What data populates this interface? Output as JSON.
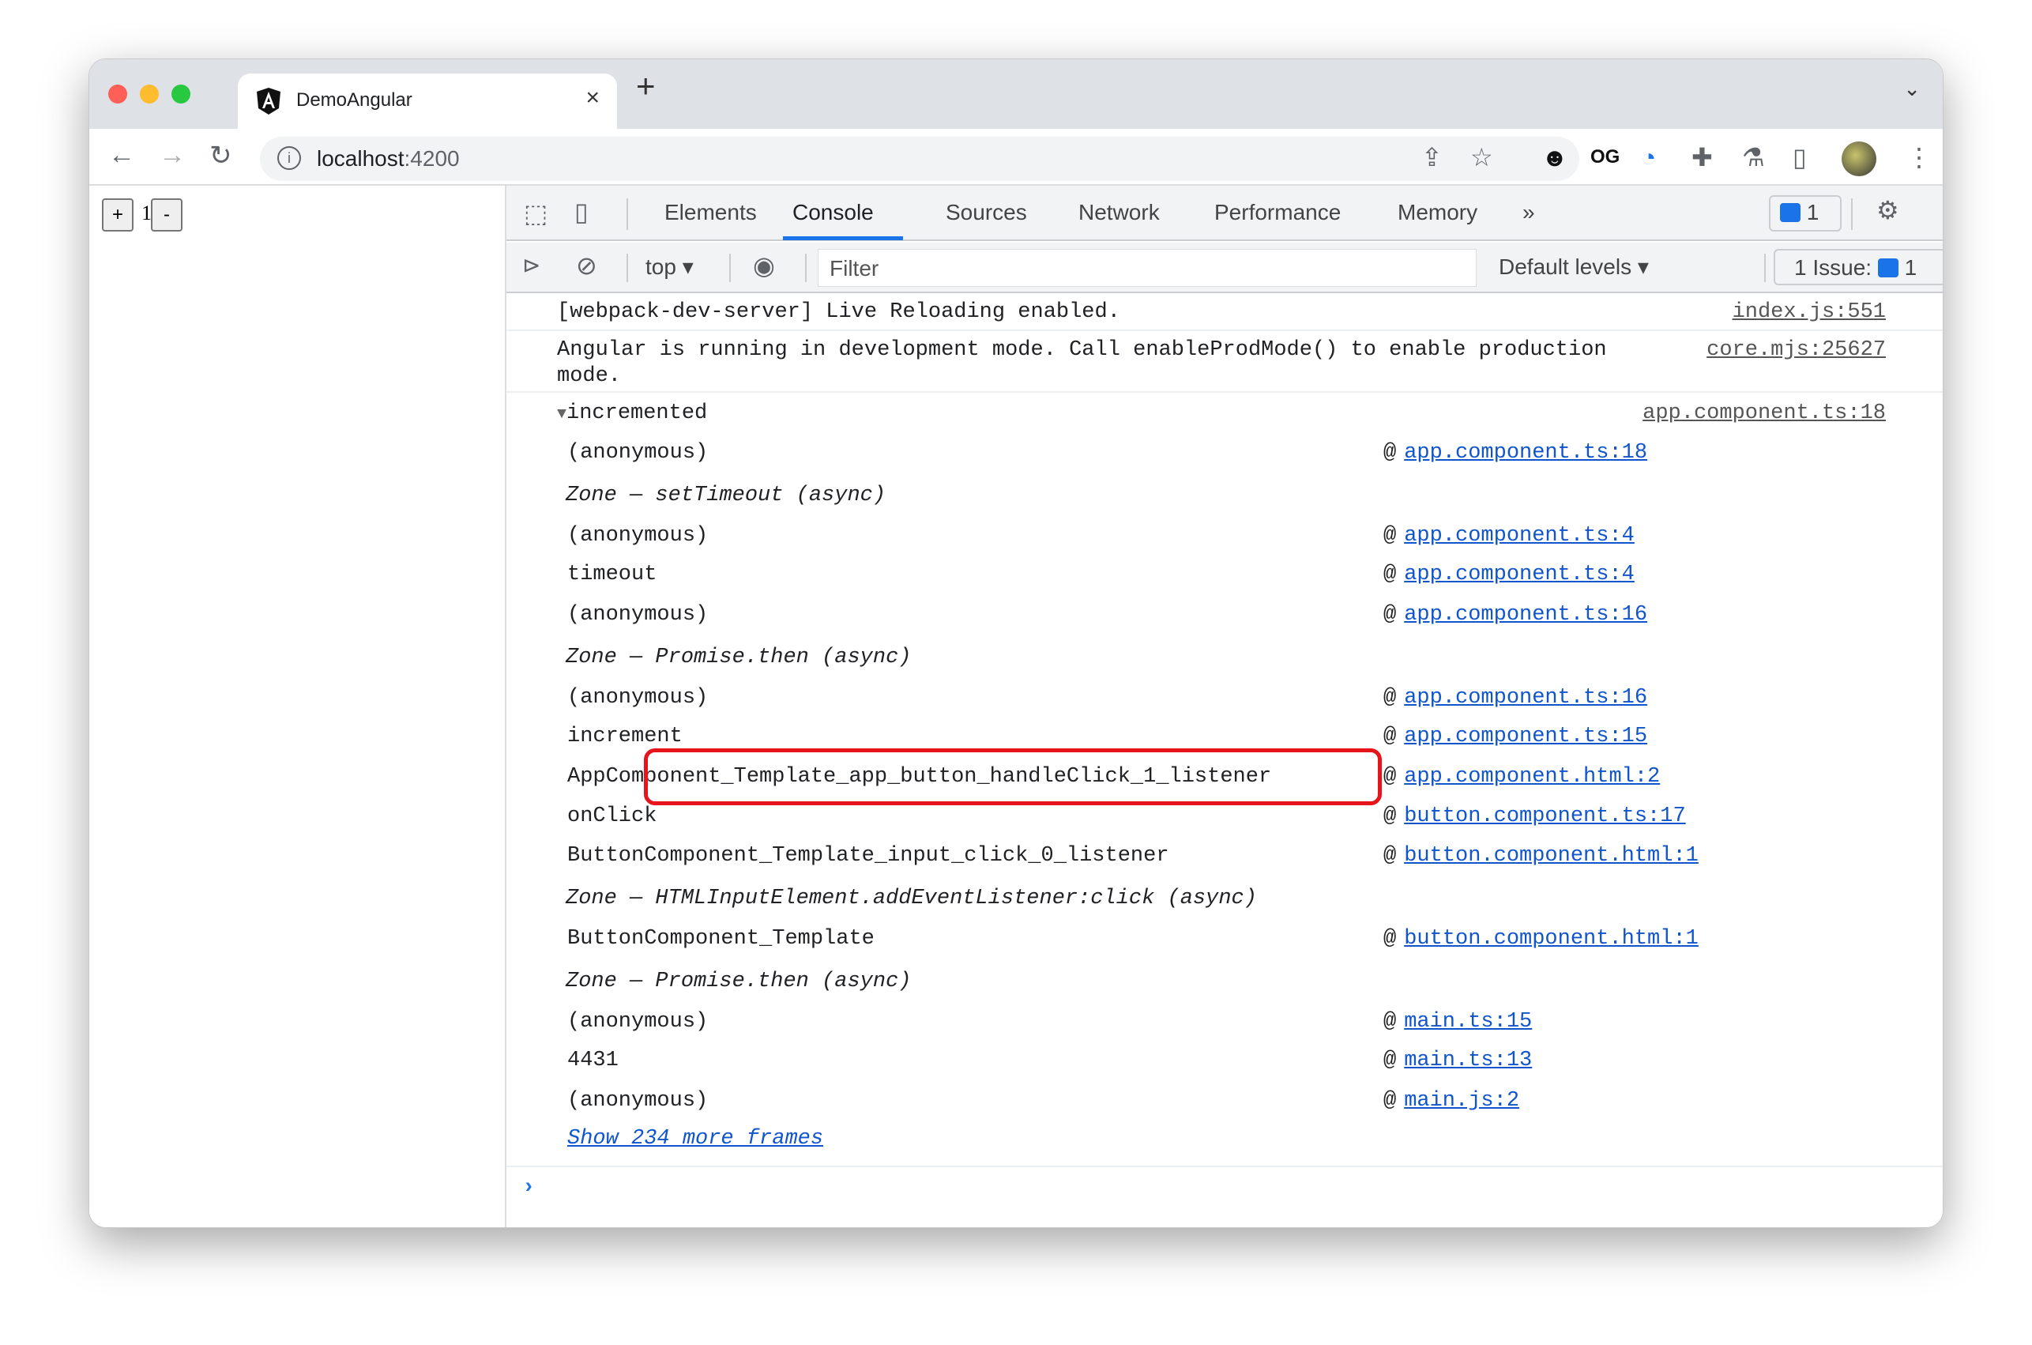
{
  "browser": {
    "tab_title": "DemoAngular",
    "url_host": "localhost",
    "url_port": ":4200",
    "icons": [
      "back-arrow-icon",
      "forward-arrow-icon",
      "reload-icon",
      "info-icon",
      "share-icon",
      "star-icon",
      "hockey-mask-extension-icon",
      "og-incognito-extension-icon",
      "password-lock-extension-icon",
      "puzzle-extensions-icon",
      "flask-labs-icon",
      "side-panel-icon",
      "profile-avatar",
      "kebab-menu-icon"
    ]
  },
  "page": {
    "plus_label": "+",
    "count": "1",
    "minus_label": "-"
  },
  "devtools": {
    "tabs": [
      "Elements",
      "Console",
      "Sources",
      "Network",
      "Performance",
      "Memory"
    ],
    "active_tab": "Console",
    "more_tabs": "»",
    "messages_badge": "1",
    "context": "top",
    "filter_placeholder": "Filter",
    "levels": "Default levels",
    "issues_label": "1 Issue:",
    "issues_count": "1",
    "accent": "#1a73e8",
    "highlight_color": "#e8141b"
  },
  "console": {
    "messages": [
      {
        "text": "[webpack-dev-server] Live Reloading enabled.",
        "source": "index.js:551"
      },
      {
        "text": "Angular is running in development mode. Call enableProdMode() to enable production\nmode.",
        "source": "core.mjs:25627"
      }
    ],
    "group": {
      "label": "incremented",
      "source": "app.component.ts:18"
    },
    "frames": [
      {
        "fn": "(anonymous)",
        "src": "app.component.ts:18"
      },
      {
        "async": "Zone — setTimeout (async)"
      },
      {
        "fn": "(anonymous)",
        "src": "app.component.ts:4"
      },
      {
        "fn": "timeout",
        "src": "app.component.ts:4"
      },
      {
        "fn": "(anonymous)",
        "src": "app.component.ts:16"
      },
      {
        "async": "Zone — Promise.then (async)"
      },
      {
        "fn": "(anonymous)",
        "src": "app.component.ts:16"
      },
      {
        "fn": "increment",
        "src": "app.component.ts:15"
      },
      {
        "fn": "AppComponent_Template_app_button_handleClick_1_listener",
        "src": "app.component.html:2",
        "highlighted": true
      },
      {
        "fn": "onClick",
        "src": "button.component.ts:17"
      },
      {
        "fn": "ButtonComponent_Template_input_click_0_listener",
        "src": "button.component.html:1"
      },
      {
        "async": "Zone — HTMLInputElement.addEventListener:click (async)"
      },
      {
        "fn": "ButtonComponent_Template",
        "src": "button.component.html:1"
      },
      {
        "async": "Zone — Promise.then (async)"
      },
      {
        "fn": "(anonymous)",
        "src": "main.ts:15"
      },
      {
        "fn": "4431",
        "src": "main.ts:13"
      },
      {
        "fn": "(anonymous)",
        "src": "main.js:2"
      }
    ],
    "show_more": "Show 234 more frames",
    "prompt": "›"
  }
}
